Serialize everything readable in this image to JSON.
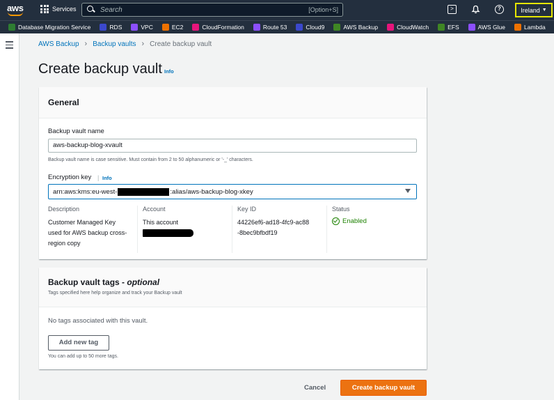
{
  "topnav": {
    "logo_text": "aws",
    "services_label": "Services",
    "search_placeholder": "Search",
    "search_shortcut": "[Option+S]",
    "region_label": "Ireland"
  },
  "favorites": [
    {
      "label": "Database Migration Service",
      "color": "#2e7d32"
    },
    {
      "label": "RDS",
      "color": "#3b48cc"
    },
    {
      "label": "VPC",
      "color": "#8c4fff"
    },
    {
      "label": "EC2",
      "color": "#ed7100"
    },
    {
      "label": "CloudFormation",
      "color": "#e7157b"
    },
    {
      "label": "Route 53",
      "color": "#8c4fff"
    },
    {
      "label": "Cloud9",
      "color": "#3b48cc"
    },
    {
      "label": "AWS Backup",
      "color": "#3f8624"
    },
    {
      "label": "CloudWatch",
      "color": "#e7157b"
    },
    {
      "label": "EFS",
      "color": "#3f8624"
    },
    {
      "label": "AWS Glue",
      "color": "#8c4fff"
    },
    {
      "label": "Lambda",
      "color": "#ed7100"
    }
  ],
  "breadcrumb": {
    "items": [
      "AWS Backup",
      "Backup vaults",
      "Create backup vault"
    ]
  },
  "page": {
    "title": "Create backup vault",
    "info": "Info"
  },
  "general": {
    "title": "General",
    "name_label": "Backup vault name",
    "name_value": "aws-backup-blog-xvault",
    "name_hint": "Backup vault name is case sensitive. Must contain from 2 to 50 alphanumeric or '-_' characters.",
    "encryption_label": "Encryption key",
    "encryption_info": "Info",
    "key_prefix": "arn:aws:kms:eu-west-",
    "key_suffix": ":alias/aws-backup-blog-xkey",
    "details": {
      "description_key": "Description",
      "description_value": "Customer Managed Key used for AWS backup cross-region copy",
      "account_key": "Account",
      "account_value": "This account",
      "keyid_key": "Key ID",
      "keyid_value": "44226ef6-ad18-4fc9-ac88-8bec9bfbdf19",
      "status_key": "Status",
      "status_value": "Enabled"
    }
  },
  "tags": {
    "title": "Backup vault tags - ",
    "title_optional": "optional",
    "subtitle": "Tags specified here help organize and track your Backup vault",
    "empty_text": "No tags associated with this vault.",
    "add_button": "Add new tag",
    "limit_text": "You can add up to 50 more tags."
  },
  "actions": {
    "cancel": "Cancel",
    "create": "Create backup vault"
  },
  "colors": {
    "nav_bg": "#232f3e",
    "link": "#0073bb",
    "primary": "#ec7211",
    "success": "#1d8102",
    "region_highlight": "#e6e600"
  }
}
